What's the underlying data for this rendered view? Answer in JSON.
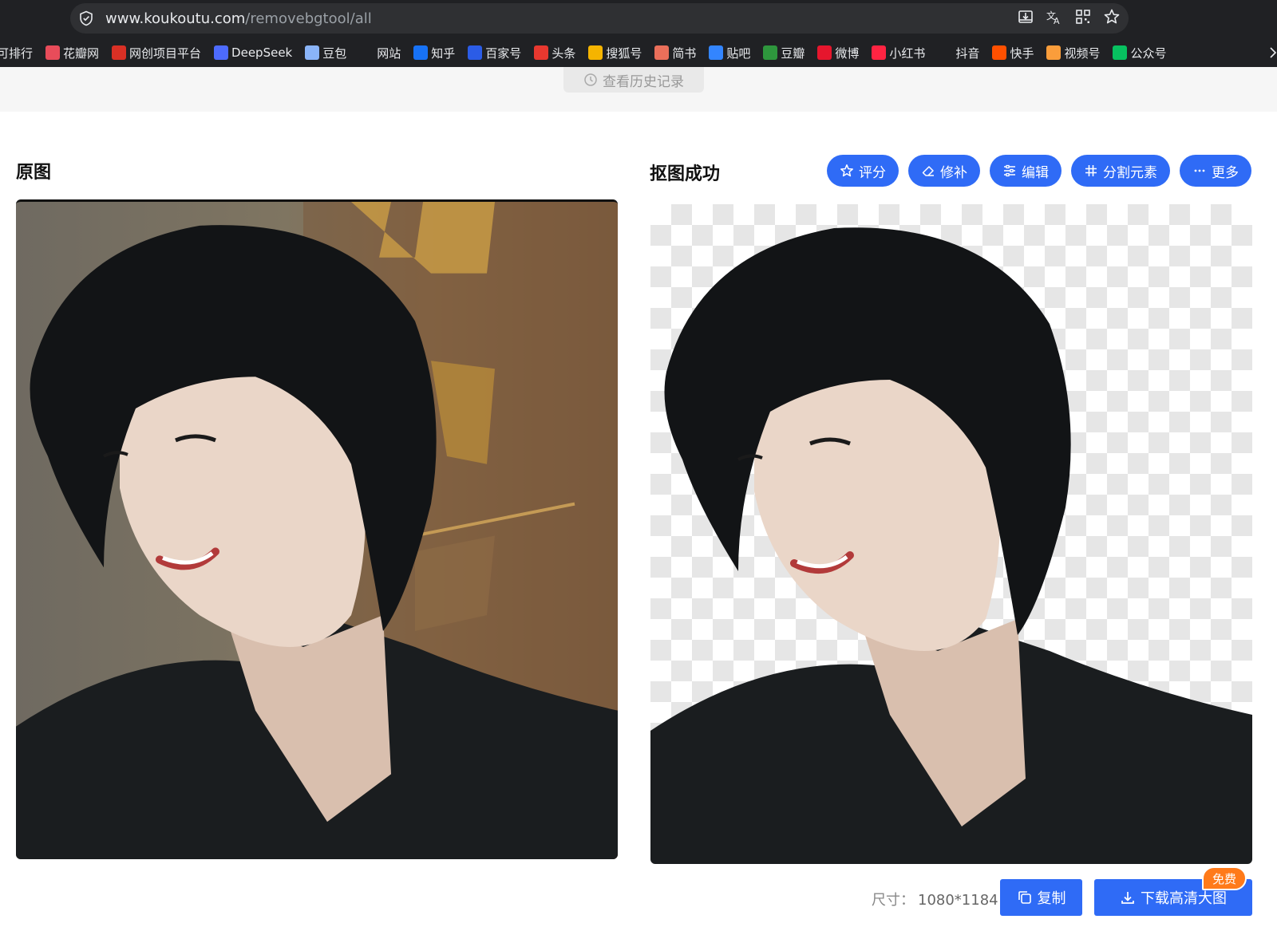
{
  "browser": {
    "url_host": "www.koukoutu.com",
    "url_path": "/removebgtool/all",
    "bookmarks": [
      {
        "label": "可排行",
        "icon": "ranking-icon",
        "color": "#202124"
      },
      {
        "label": "花瓣网",
        "icon": "huaban-icon",
        "color": "#e84c5a"
      },
      {
        "label": "网创项目平台",
        "icon": "fox-icon",
        "color": "#d93025"
      },
      {
        "label": "DeepSeek",
        "icon": "deepseek-whale-icon",
        "color": "#4d6bfe"
      },
      {
        "label": "豆包",
        "icon": "doubao-icon",
        "color": "#8ab4f8"
      },
      {
        "label": "网站",
        "icon": "globe-icon",
        "color": "#202124"
      },
      {
        "label": "知乎",
        "icon": "zhihu-icon",
        "color": "#1772f6"
      },
      {
        "label": "百家号",
        "icon": "baijiahao-icon",
        "color": "#2b5ce6"
      },
      {
        "label": "头条",
        "icon": "toutiao-icon",
        "color": "#e8382f"
      },
      {
        "label": "搜狐号",
        "icon": "sohu-icon",
        "color": "#f5b400"
      },
      {
        "label": "简书",
        "icon": "jianshu-icon",
        "color": "#ea6f5a"
      },
      {
        "label": "贴吧",
        "icon": "tieba-paw-icon",
        "color": "#3385ff"
      },
      {
        "label": "豆瓣",
        "icon": "douban-icon",
        "color": "#2e963d"
      },
      {
        "label": "微博",
        "icon": "weibo-icon",
        "color": "#e6162d"
      },
      {
        "label": "小红书",
        "icon": "xiaohongshu-icon",
        "color": "#ff2442"
      },
      {
        "label": "抖音",
        "icon": "douyin-icon",
        "color": "#202124"
      },
      {
        "label": "快手",
        "icon": "kuaishou-icon",
        "color": "#ff5000"
      },
      {
        "label": "视频号",
        "icon": "channels-icon",
        "color": "#fa9d3b"
      },
      {
        "label": "公众号",
        "icon": "wechat-mp-icon",
        "color": "#07c160"
      }
    ]
  },
  "page": {
    "history_label": "查看历史记录",
    "original_title": "原图",
    "result_title": "抠图成功",
    "actions": [
      {
        "label": "评分",
        "icon": "star-icon"
      },
      {
        "label": "修补",
        "icon": "eraser-icon"
      },
      {
        "label": "编辑",
        "icon": "sliders-icon"
      },
      {
        "label": "分割元素",
        "icon": "hash-icon"
      },
      {
        "label": "更多",
        "icon": "ellipsis-icon"
      }
    ],
    "size_label": "尺寸：",
    "size_value": "1080*1184",
    "copy_label": "复制",
    "download_label": "下载高清大图",
    "free_badge": "免费"
  },
  "colors": {
    "accent": "#2f6bf6",
    "badge": "#ff7a1a",
    "chrome_bg": "#202124"
  }
}
